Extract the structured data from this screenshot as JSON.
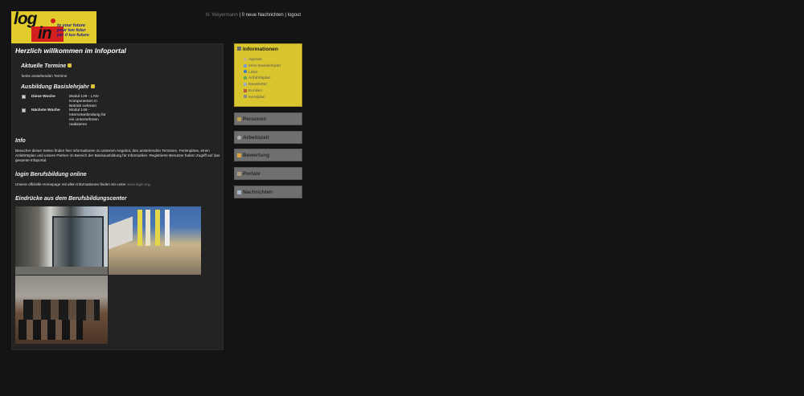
{
  "logo": {
    "word_top": "log",
    "word_bottom": "in",
    "tagline": [
      "to your future",
      "pour ton futur",
      "per il tuo futuro"
    ]
  },
  "userbar": {
    "username": "N. Weyermann",
    "separator1": " | ",
    "messages_link": "0 neue Nachrichten",
    "separator2": " | ",
    "logout_link": "logout"
  },
  "main": {
    "title": "Herzlich willkommen im Infoportal",
    "termine": {
      "heading": "Aktuelle Termine",
      "text": "keine anstehenden Termine"
    },
    "ausbildung": {
      "heading": "Ausbildung Basislehrjahr",
      "rows": [
        {
          "label": "Diese Woche",
          "value": "Modul 129 - LAN-Komponenten in Betrieb nehmen"
        },
        {
          "label": "Nächste Woche",
          "value": "Modul 146 - Internetanbindung für ein Unternehmen realisieren"
        }
      ]
    },
    "info": {
      "heading": "Info",
      "text": "Besucher dieser Seiten finden hier Informationen zu unserem Angebot, den anstehenden Terminen, Ferienpläne, einen Anfahrtsplan und unsere Partner im Bereich der Basisausbildung für Informatiker. Registrierte Benutzer haben Zugriff auf das gesamte Infoportal."
    },
    "online": {
      "heading": "login Berufsbildung online",
      "text_before": "Unsere offizielle Homepage mit allen Informationen finden Sie unter ",
      "link": "www.login.org",
      "text_after": "."
    },
    "gallery": {
      "heading": "Eindrücke aus dem Berufsbildungscenter"
    }
  },
  "sidebar": {
    "info_box": {
      "title": "Informationen",
      "items": [
        {
          "label": "Agenda",
          "icon": "calendar-icon",
          "color": "#c9b27a"
        },
        {
          "label": "Infos Basislehrjahr",
          "icon": "document-icon",
          "color": "#7d9acb"
        },
        {
          "label": "Links",
          "icon": "globe-icon",
          "color": "#3c78c8"
        },
        {
          "label": "Anfahrtsplan",
          "icon": "map-icon",
          "color": "#6aa84f"
        },
        {
          "label": "Newsletter",
          "icon": "newsletter-icon",
          "color": "#9ab0c8"
        },
        {
          "label": "Kunden",
          "icon": "customers-icon",
          "color": "#c05a3a"
        },
        {
          "label": "Kernlplan",
          "icon": "pencil-icon",
          "color": "#8c8c8c"
        }
      ]
    },
    "buttons": [
      {
        "label": "Personen",
        "icon": "persons-icon",
        "color": "#b8a050"
      },
      {
        "label": "Arbeitszeit",
        "icon": "clock-icon",
        "color": "#b0b0b0"
      },
      {
        "label": "Bewertung",
        "icon": "rating-icon",
        "color": "#e0a040"
      },
      {
        "label": "Portale",
        "icon": "portal-icon",
        "color": "#a89a7a"
      },
      {
        "label": "Nachrichten",
        "icon": "mail-icon",
        "color": "#a8b4c8"
      }
    ]
  },
  "colors": {
    "background": "#141414",
    "panel": "#232323",
    "accent_yellow": "#d9c62f",
    "button_grey": "#6f6f6f",
    "logo_red": "#d41f1f"
  }
}
